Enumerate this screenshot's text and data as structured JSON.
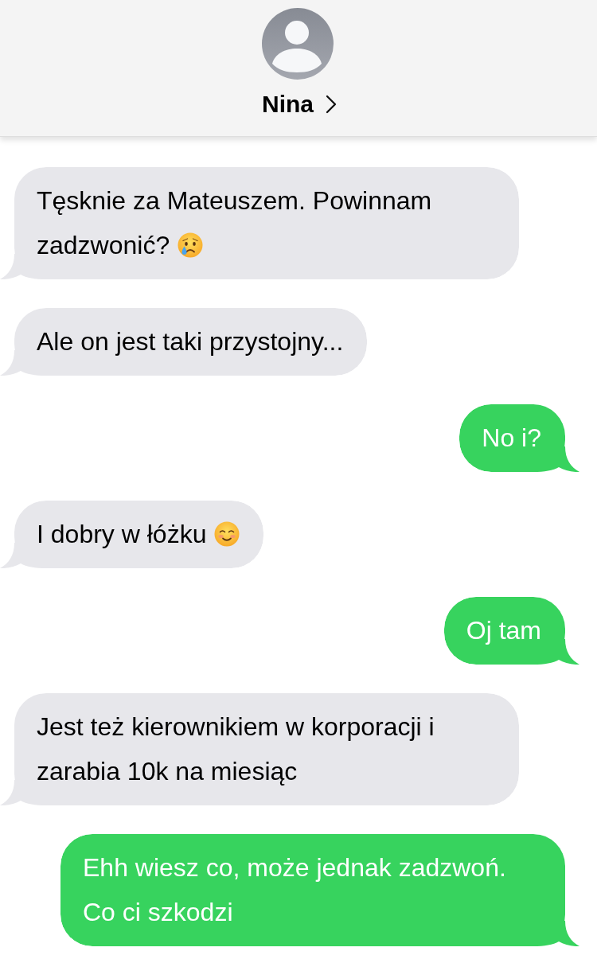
{
  "header": {
    "name": "Nina"
  },
  "messages": [
    {
      "kind": "received",
      "lines": [
        "Tęsknie za Mateuszem. Powinnam",
        "zadzwonić?"
      ],
      "emoji": {
        "kind": "crying-face"
      }
    },
    {
      "kind": "received",
      "lines": [
        "Ale on jest taki przystojny..."
      ]
    },
    {
      "kind": "sent",
      "lines": [
        "No i?"
      ]
    },
    {
      "kind": "received",
      "lines": [
        "I dobry w łóżku"
      ],
      "emoji": {
        "kind": "smiling-face"
      }
    },
    {
      "kind": "sent",
      "lines": [
        "Oj tam"
      ]
    },
    {
      "kind": "received",
      "lines": [
        "Jest też kierownikiem w korporacji i",
        "zarabia 10k na miesiąc"
      ]
    },
    {
      "kind": "sent",
      "lines": [
        "Ehh wiesz co, może jednak zadzwoń.",
        "Co ci szkodzi"
      ]
    }
  ]
}
